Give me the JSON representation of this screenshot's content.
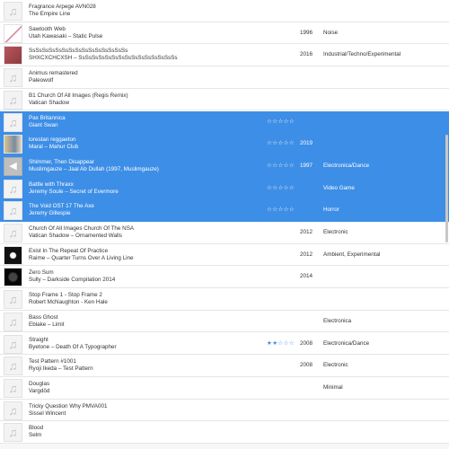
{
  "tracks": [
    {
      "title": "Fragrance Arpege AVN028",
      "subtitle": "The Empire Line",
      "year": "",
      "genre": "",
      "rating": "",
      "selected": false,
      "art": "note-icon"
    },
    {
      "title": "Sawtooth Web",
      "subtitle": "Utah Kawasaki – Static Pulse",
      "year": "1996",
      "genre": "Noise",
      "rating": "",
      "selected": false,
      "art": "album-art-diagonal"
    },
    {
      "title": "SsSsSsSsSsSsSsSsSsSsSsSsSsSsSs",
      "subtitle": "SHXCXCHCXSH – SsSsSsSsSsSsSsSsSsSsSsSsSsSsSs",
      "year": "2016",
      "genre": "Industrial/Techno/Experimental",
      "rating": "",
      "selected": false,
      "art": "album-art-red"
    },
    {
      "title": "Animus remastered",
      "subtitle": "Paleowolf",
      "year": "",
      "genre": "",
      "rating": "",
      "selected": false,
      "art": "note-icon"
    },
    {
      "title": "B1 Church Of All Images (Regis Remix)",
      "subtitle": "Vatican Shadow",
      "year": "",
      "genre": "",
      "rating": "",
      "selected": false,
      "art": "note-icon"
    },
    {
      "title": "Pax Britannica",
      "subtitle": "Giant Swan",
      "year": "",
      "genre": "",
      "rating": "☆☆☆☆☆",
      "selected": true,
      "art": "note-icon"
    },
    {
      "title": "lorestan reggaeton",
      "subtitle": "Maral – Mahur Club",
      "year": "2019",
      "genre": "",
      "rating": "☆☆☆☆☆",
      "selected": true,
      "art": "album-art-figure"
    },
    {
      "title": "Shimmer, Then Disappear",
      "subtitle": "Muslimgauze – Jaal Ab Dullah (1997, Muslimgauze)",
      "year": "1997",
      "genre": "Electronica/Dance",
      "rating": "☆☆☆☆☆",
      "selected": true,
      "art": "play-icon"
    },
    {
      "title": "Battle with Thraxx",
      "subtitle": "Jeremy Soule – Secret of Evermore",
      "year": "",
      "genre": "Video Game",
      "rating": "☆☆☆☆☆",
      "selected": true,
      "art": "note-icon"
    },
    {
      "title": "The Void OST 17 The Axe",
      "subtitle": "Jeremy Gillespie",
      "year": "",
      "genre": "Horror",
      "rating": "☆☆☆☆☆",
      "selected": true,
      "art": "note-icon"
    },
    {
      "title": "Church Of All Images Church Of The NSA",
      "subtitle": "Vatican Shadow – Ornamented Walls",
      "year": "2012",
      "genre": "Electronic",
      "rating": "",
      "selected": false,
      "art": "note-icon"
    },
    {
      "title": "Exist In The Repeat Of Practice",
      "subtitle": "Raime – Quarter Turns Over A Living Line",
      "year": "2012",
      "genre": "Ambient, Experimental",
      "rating": "",
      "selected": false,
      "art": "album-art-dark"
    },
    {
      "title": "Zero Sum",
      "subtitle": "Sully – Darkside Compilation 2014",
      "year": "2014",
      "genre": "",
      "rating": "",
      "selected": false,
      "art": "album-art-black"
    },
    {
      "title": "Stop Frame 1 - Stop Frame 2",
      "subtitle": "Robert McNaughton - Ken Hale",
      "year": "",
      "genre": "",
      "rating": "",
      "selected": false,
      "art": "note-icon"
    },
    {
      "title": "Bass Ghost",
      "subtitle": "Eblake – Limit",
      "year": "",
      "genre": "Electronica",
      "rating": "",
      "selected": false,
      "art": "note-icon"
    },
    {
      "title": "Straight",
      "subtitle": "Byetone – Death Of A Typographer",
      "year": "2008",
      "genre": "Electronica/Dance",
      "rating": "★★☆☆☆",
      "selected": false,
      "art": "note-icon"
    },
    {
      "title": "Test Pattern #1001",
      "subtitle": "Ryoji Ikeda – Test Pattern",
      "year": "2008",
      "genre": "Electronic",
      "rating": "",
      "selected": false,
      "art": "note-icon"
    },
    {
      "title": "Douglas",
      "subtitle": "Vargdöd",
      "year": "",
      "genre": "Minimal",
      "rating": "",
      "selected": false,
      "art": "note-icon"
    },
    {
      "title": "Tricky Question Why PMVA001",
      "subtitle": "Sissel Wincent",
      "year": "",
      "genre": "",
      "rating": "",
      "selected": false,
      "art": "note-icon"
    },
    {
      "title": "Blood",
      "subtitle": "Selm",
      "year": "",
      "genre": "",
      "rating": "",
      "selected": false,
      "art": "note-icon"
    }
  ],
  "colors": {
    "selection": "#3d8ee6",
    "star": "#3d8ee6",
    "selected_text": "#ffffff",
    "text": "#333333"
  }
}
